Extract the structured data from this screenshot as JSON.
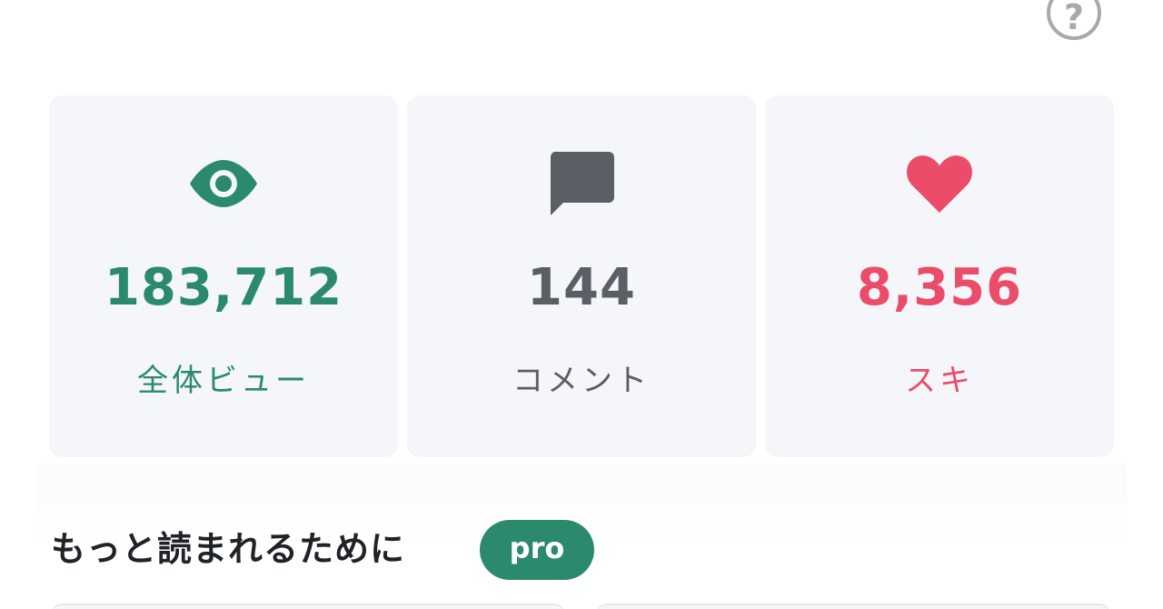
{
  "help": {
    "label": "?"
  },
  "stats": {
    "views": {
      "value": "183,712",
      "label": "全体ビュー",
      "icon": "eye-icon",
      "color": "#2b8a6e"
    },
    "comments": {
      "value": "144",
      "label": "コメント",
      "icon": "comment-icon",
      "color": "#5a5f66"
    },
    "likes": {
      "value": "8,356",
      "label": "スキ",
      "icon": "heart-icon",
      "color": "#ea4c6a"
    }
  },
  "section": {
    "title": "もっと読まれるために",
    "badge": "pro"
  }
}
